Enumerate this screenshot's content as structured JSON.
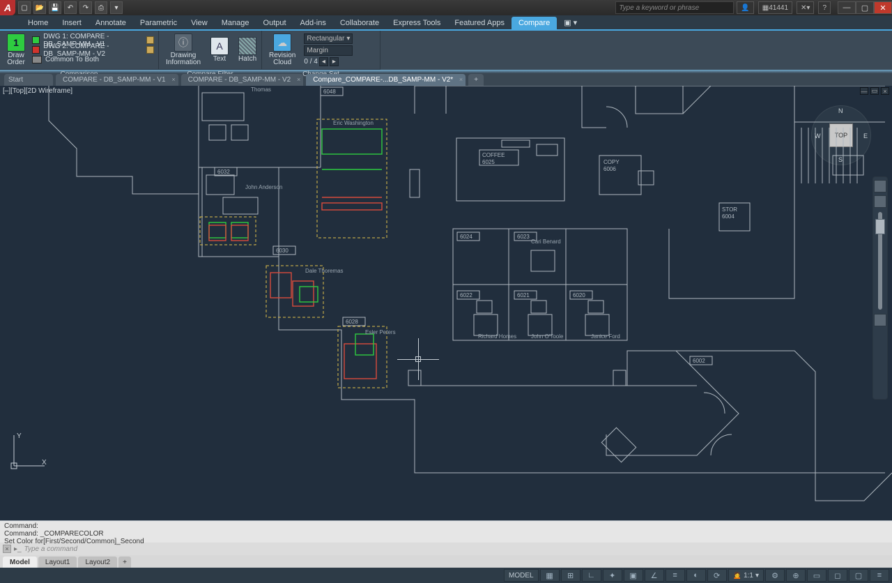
{
  "qat": {
    "icons": [
      "new",
      "open",
      "save",
      "undo",
      "redo",
      "print",
      "more"
    ]
  },
  "search": {
    "placeholder": "Type a keyword or phrase"
  },
  "titlebar_right": {
    "signin_icon": "👤",
    "coords": "41441",
    "help": "?"
  },
  "ribbon": {
    "tabs": [
      "Home",
      "Insert",
      "Annotate",
      "Parametric",
      "View",
      "Manage",
      "Output",
      "Add-ins",
      "Collaborate",
      "Express Tools",
      "Featured Apps",
      "Compare"
    ],
    "active": "Compare",
    "panels": {
      "comparison": {
        "label": "Comparison",
        "draw_order_label": "Draw\nOrder",
        "draw_order_num": "1",
        "rows": {
          "dwg1": "DWG 1:  COMPARE - DB_SAMP-MM - V1",
          "dwg2": "DWG 2:  COMPARE - DB_SAMP-MM - V2",
          "common": "Common To Both"
        }
      },
      "filter": {
        "label": "Compare Filter",
        "info_label": "Drawing\nInformation",
        "text_label": "Text",
        "hatch_label": "Hatch"
      },
      "changeset": {
        "label": "Change Set",
        "revcloud_label": "Revision\nCloud",
        "shape_label": "Rectangular",
        "margin_label": "Margin",
        "counter": "0  /  4"
      }
    }
  },
  "file_tabs": {
    "items": [
      "Start",
      "COMPARE - DB_SAMP-MM - V1",
      "COMPARE - DB_SAMP-MM - V2",
      "Compare_COMPARE-...DB_SAMP-MM - V2*"
    ],
    "active_index": 3
  },
  "viewport": {
    "label": "[–][Top][2D Wireframe]"
  },
  "viewcube": {
    "top": "TOP",
    "n": "N",
    "s": "S",
    "e": "E",
    "w": "W"
  },
  "rooms": {
    "r6048": "6048",
    "r6032": "6032",
    "r6030": "6030",
    "r6028": "6028",
    "r6024": "6024",
    "r6023": "6023",
    "r6022": "6022",
    "r6021": "6021",
    "r6020": "6020",
    "r6002": "6002",
    "copy": "COPY",
    "copy_n": "6006",
    "stor": "STOR",
    "stor_n": "6004",
    "coffee": "COFFEE",
    "coffee_n": "6025"
  },
  "names": {
    "thomas": "Thomas",
    "washington": "Eric\nWashington",
    "anderson": "John\nAnderson",
    "dthoremas": "Dale\nThoremas",
    "peters": "Esler\nPeters",
    "benard": "Cari\nBenard",
    "homes": "Richard\nHomes",
    "otoole": "John\nO'Toole",
    "ford": "Janice\nFord"
  },
  "ucs": {
    "x": "X",
    "y": "Y"
  },
  "cmd_history": {
    "l1": "Command:",
    "l2": "Command: _COMPARECOLOR",
    "l3": "Set Color for[First/Second/Common]_Second"
  },
  "cmd_line": {
    "placeholder": "Type a command"
  },
  "layout_tabs": {
    "items": [
      "Model",
      "Layout1",
      "Layout2"
    ],
    "active_index": 0
  },
  "status": {
    "model": "MODEL",
    "scale": "1:1"
  }
}
